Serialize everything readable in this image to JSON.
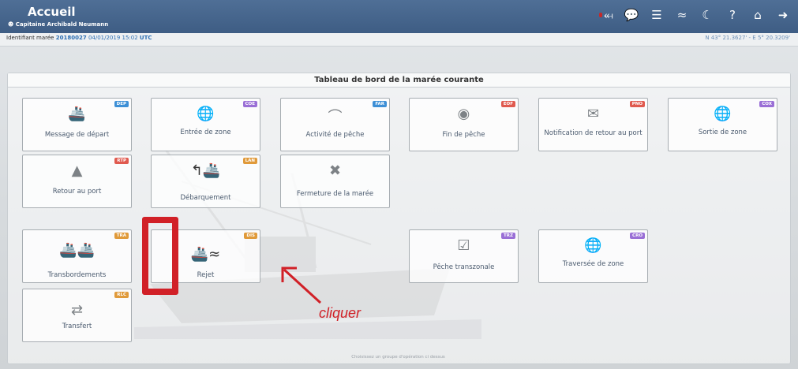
{
  "header": {
    "title": "Accueil",
    "captain": "Capitaine Archibald Neumann",
    "icons": [
      "usb-icon",
      "chat-icon",
      "database-icon",
      "wifi-icon",
      "moon-icon",
      "help-icon",
      "home-icon",
      "logout-icon"
    ]
  },
  "infobar": {
    "trip_label": "Identifiant marée",
    "trip_id": "20180027",
    "datetime": "04/01/2019 15:02",
    "tz": "UTC",
    "coords": "N 43° 21.3627' - E 5° 20.3209'"
  },
  "panel": {
    "title": "Tableau de bord de la marée courante"
  },
  "tiles": [
    {
      "code": "DEP",
      "label": "Message de départ",
      "color": "#3d8fd6"
    },
    {
      "code": "COE",
      "label": "Entrée de zone",
      "color": "#9a6fd6"
    },
    {
      "code": "FAR",
      "label": "Activité de pêche",
      "color": "#3d8fd6"
    },
    {
      "code": "EOF",
      "label": "Fin de pêche",
      "color": "#e05a4f"
    },
    {
      "code": "PNO",
      "label": "Notification de retour au port",
      "color": "#e05a4f"
    },
    {
      "code": "COX",
      "label": "Sortie de zone",
      "color": "#9a6fd6"
    },
    {
      "code": "RTP",
      "label": "Retour au port",
      "color": "#e05a4f"
    },
    {
      "code": "LAN",
      "label": "Débarquement",
      "color": "#e09a3a"
    },
    {
      "code": "",
      "label": "Fermeture de la marée",
      "color": "#3d8fd6"
    },
    {
      "code": "TRA",
      "label": "Transbordements",
      "color": "#e09a3a"
    },
    {
      "code": "DIS",
      "label": "Rejet",
      "color": "#e09a3a"
    },
    {
      "code": "TRZ",
      "label": "Pêche transzonale",
      "color": "#9a6fd6"
    },
    {
      "code": "CRO",
      "label": "Traversée de zone",
      "color": "#9a6fd6"
    },
    {
      "code": "RLC",
      "label": "Transfert",
      "color": "#e09a3a"
    }
  ],
  "footer": "Choisissez un groupe d'opération ci dessus",
  "annotation": {
    "text": "cliquer",
    "color": "#d12027"
  }
}
